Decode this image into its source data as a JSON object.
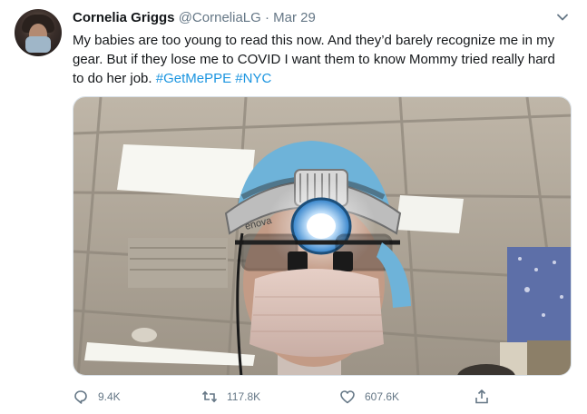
{
  "tweet": {
    "author_name": "Cornelia Griggs",
    "handle": "@CorneliaLG",
    "separator": "·",
    "date": "Mar 29",
    "text": "My babies are too young to read this now. And they’d barely recognize me in my gear. But if they lose me to COVID I want them to know Mommy tried really hard to do her job. ",
    "hashtags": [
      "#GetMePPE",
      "#NYC"
    ],
    "media": {
      "headlamp_brand": "enova",
      "headband_label": "enova"
    }
  },
  "actions": {
    "reply_count": "9.4K",
    "retweet_count": "117.8K",
    "like_count": "607.6K"
  },
  "icons": {
    "caret": "chevron-down-icon",
    "reply": "reply-icon",
    "retweet": "retweet-icon",
    "like": "heart-icon",
    "share": "share-icon"
  },
  "colors": {
    "link": "#1b95e0",
    "secondary_text": "#657786",
    "primary_text": "#14171a"
  }
}
